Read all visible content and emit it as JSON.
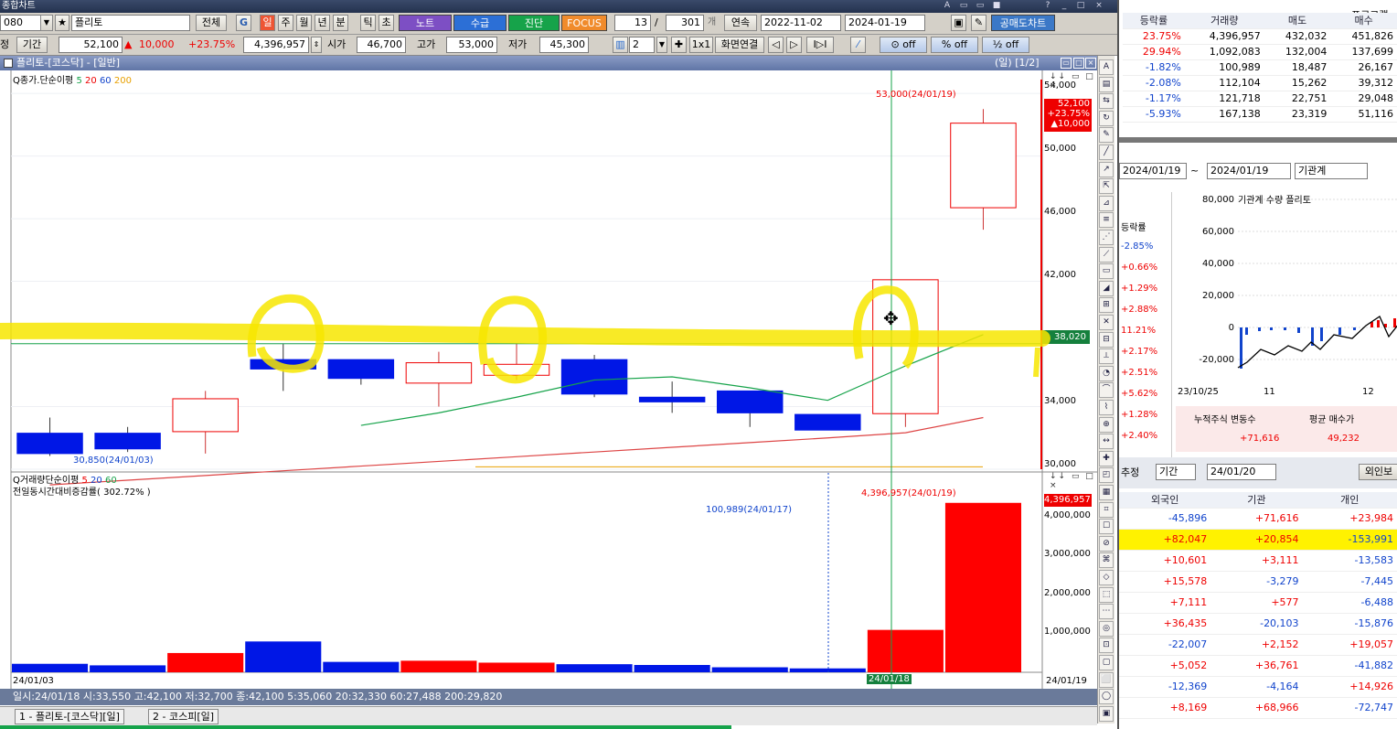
{
  "window": {
    "title": "종합차트",
    "controls": [
      "A",
      "□",
      "□",
      "■",
      "?",
      "_",
      "□",
      "×"
    ]
  },
  "toolbar1": {
    "code": "080",
    "name": "플리토",
    "all_label": "전체",
    "periods": [
      "일",
      "주",
      "월",
      "년",
      "분",
      "틱",
      "초"
    ],
    "tags": {
      "note": "노트",
      "supply": "수급",
      "diagnose": "진단",
      "focus": "FOCUS"
    },
    "count": "13",
    "total": "301",
    "total_suffix": "개",
    "continuous": "연속",
    "date_from": "2022-11-02",
    "date_to": "2024-01-19",
    "short_chart": "공매도차트"
  },
  "toolbar2": {
    "period_label": "기간",
    "price": "52,100",
    "change": "10,000",
    "change_pct": "+23.75%",
    "volume": "4,396,957",
    "open_label": "시가",
    "open": "46,700",
    "high_label": "고가",
    "high": "53,000",
    "low_label": "저가",
    "low": "45,300",
    "split": "2",
    "ratio": "1x1",
    "screen_link": "화면연결",
    "off1": "off",
    "off2": "off",
    "off3": "off"
  },
  "chart": {
    "title": "플리토-[코스닥] - [일반]",
    "period_info": "(일) [1/2]",
    "price_legend": "종가.단순이평",
    "ma_periods": [
      "5",
      "20",
      "60",
      "200"
    ],
    "vol_legend": "거래량단순이평",
    "vol_ma_periods": [
      "5",
      "20",
      "60"
    ],
    "vol_sub": "전일동시간대비증감률( 302.72% )",
    "price_axis": [
      "54,000",
      "50,000",
      "46,000",
      "42,000",
      "34,000",
      "30,000"
    ],
    "vol_axis": [
      "4,000,000",
      "3,000,000",
      "2,000,000",
      "1,000,000"
    ],
    "current_price": "52,100",
    "current_pct": "+23.75%",
    "current_chg": "▲10,000",
    "crosshair_price": "38,020",
    "vol_last": "4,396,957",
    "high_note": "53,000(24/01/19)",
    "low_note": "30,850(24/01/03)",
    "vol_high_note": "4,396,957(24/01/19)",
    "vol_low_note": "100,989(24/01/17)",
    "x_start": "24/01/03",
    "x_cross": "24/01/18",
    "x_end": "24/01/19",
    "status": "일시:24/01/18 시:33,550 고:42,100 저:32,700 종:42,100 5:35,060 20:32,330 60:27,488 200:29,820",
    "tabs": [
      "1 - 플리토-[코스닥][일]",
      "2 - 코스피[일]"
    ]
  },
  "chart_data": {
    "type": "candlestick",
    "candles": [
      {
        "o": 32300,
        "h": 33300,
        "l": 30850,
        "c": 31000
      },
      {
        "o": 32300,
        "h": 32700,
        "l": 31100,
        "c": 31300
      },
      {
        "o": 32400,
        "h": 35000,
        "l": 31000,
        "c": 34500
      },
      {
        "o": 37000,
        "h": 38000,
        "l": 35000,
        "c": 36400
      },
      {
        "o": 37000,
        "h": 37000,
        "l": 35400,
        "c": 35800
      },
      {
        "o": 35500,
        "h": 37500,
        "l": 34000,
        "c": 36800
      },
      {
        "o": 36000,
        "h": 38000,
        "l": 35700,
        "c": 36700
      },
      {
        "o": 37000,
        "h": 37300,
        "l": 34600,
        "c": 34800
      },
      {
        "o": 34600,
        "h": 35600,
        "l": 33600,
        "c": 34300
      },
      {
        "o": 35000,
        "h": 35000,
        "l": 32700,
        "c": 33600
      },
      {
        "o": 33500,
        "h": 33500,
        "l": 32500,
        "c": 32500
      },
      {
        "o": 33550,
        "h": 42100,
        "l": 32700,
        "c": 42100
      },
      {
        "o": 46700,
        "h": 53000,
        "l": 45300,
        "c": 52100
      }
    ],
    "ma5": [
      null,
      null,
      null,
      null,
      32800,
      33600,
      34600,
      35700,
      35900,
      35200,
      34400,
      36600,
      38600
    ],
    "ma20": [
      29000,
      29300,
      29600,
      29900,
      30200,
      30500,
      30800,
      31100,
      31400,
      31700,
      32000,
      32330,
      33300
    ],
    "volume": [
      220000,
      180000,
      500000,
      800000,
      270000,
      300000,
      250000,
      210000,
      190000,
      130000,
      100989,
      1100000,
      4396957
    ],
    "ylim": [
      30000,
      55000
    ],
    "vol_ylim": [
      0,
      4700000
    ]
  },
  "rp_top": {
    "headers": [
      "등락률",
      "거래량",
      "매도",
      "매수"
    ],
    "program": "프로그램",
    "rows": [
      [
        "23.75%",
        "4,396,957",
        "432,032",
        "451,826"
      ],
      [
        "29.94%",
        "1,092,083",
        "132,004",
        "137,699"
      ],
      [
        "-1.82%",
        "100,989",
        "18,487",
        "26,167"
      ],
      [
        "-2.08%",
        "112,104",
        "15,262",
        "39,312"
      ],
      [
        "-1.17%",
        "121,718",
        "22,751",
        "29,048"
      ],
      [
        "-5.93%",
        "167,138",
        "23,319",
        "51,116"
      ]
    ]
  },
  "rp_mid": {
    "date_from": "2024/01/19",
    "date_to": "2024/01/19",
    "investor": "기관계",
    "col_head": "등락률",
    "pcts": [
      "-2.85%",
      "+0.66%",
      "+1.29%",
      "+2.88%",
      "11.21%",
      "+2.17%",
      "+2.51%",
      "+5.62%",
      "+1.28%",
      "+2.40%"
    ],
    "legend": "기관계 수량 플리토",
    "yaxis": [
      "80,000",
      "60,000",
      "40,000",
      "20,000",
      "0",
      "-20,000"
    ],
    "xaxis": [
      "23/10/25",
      "11",
      "12"
    ],
    "labels": [
      "누적주식 변동수",
      "평균 매수가"
    ],
    "values": [
      "+71,616",
      "49,232"
    ]
  },
  "rp_bot": {
    "label": "추정",
    "period": "기간",
    "date": "24/01/20",
    "button": "외인보",
    "headers": [
      "외국인",
      "기관",
      "개인"
    ],
    "rows": [
      [
        "-45,896",
        "+71,616",
        "+23,984"
      ],
      [
        "+82,047",
        "+20,854",
        "-153,991"
      ],
      [
        "+10,601",
        "+3,111",
        "-13,583"
      ],
      [
        "+15,578",
        "-3,279",
        "-7,445"
      ],
      [
        "+7,111",
        "+577",
        "-6,488"
      ],
      [
        "+36,435",
        "-20,103",
        "-15,876"
      ],
      [
        "-22,007",
        "+2,152",
        "+19,057"
      ],
      [
        "+5,052",
        "+36,761",
        "-41,882"
      ],
      [
        "-12,369",
        "-4,164",
        "+14,926"
      ],
      [
        "+8,169",
        "+68,966",
        "-72,747"
      ]
    ]
  }
}
